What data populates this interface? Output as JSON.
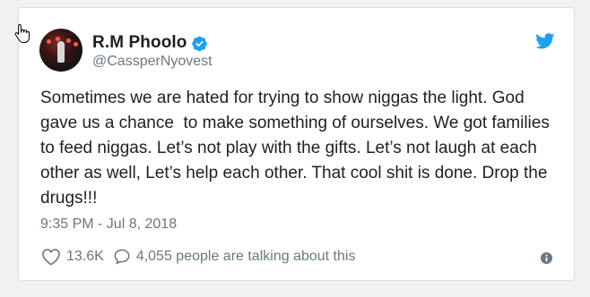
{
  "author": {
    "name": "R.M Phoolo",
    "handle": "@CassperNyovest",
    "verified": true
  },
  "tweet": {
    "text": "Sometimes we are hated for trying to show niggas the light. God gave us a chance  to make something of ourselves. We got families to feed niggas. Let’s not play with the gifts. Let’s not laugh at each other as well, Let’s help each other. That cool shit is done. Drop the drugs!!!",
    "timestamp": "9:35 PM - Jul 8, 2018"
  },
  "actions": {
    "likes": "13.6K",
    "talking": "4,055 people are talking about this"
  },
  "icons": {
    "verified": "verified-badge-icon",
    "brand": "twitter-bird-icon",
    "like": "heart-icon",
    "reply": "speech-bubble-icon",
    "info": "info-icon",
    "cursor": "hand-cursor-icon"
  },
  "colors": {
    "brand": "#1da1f2",
    "text": "#1c2022",
    "muted": "#697882",
    "border": "#d9dfe3"
  }
}
